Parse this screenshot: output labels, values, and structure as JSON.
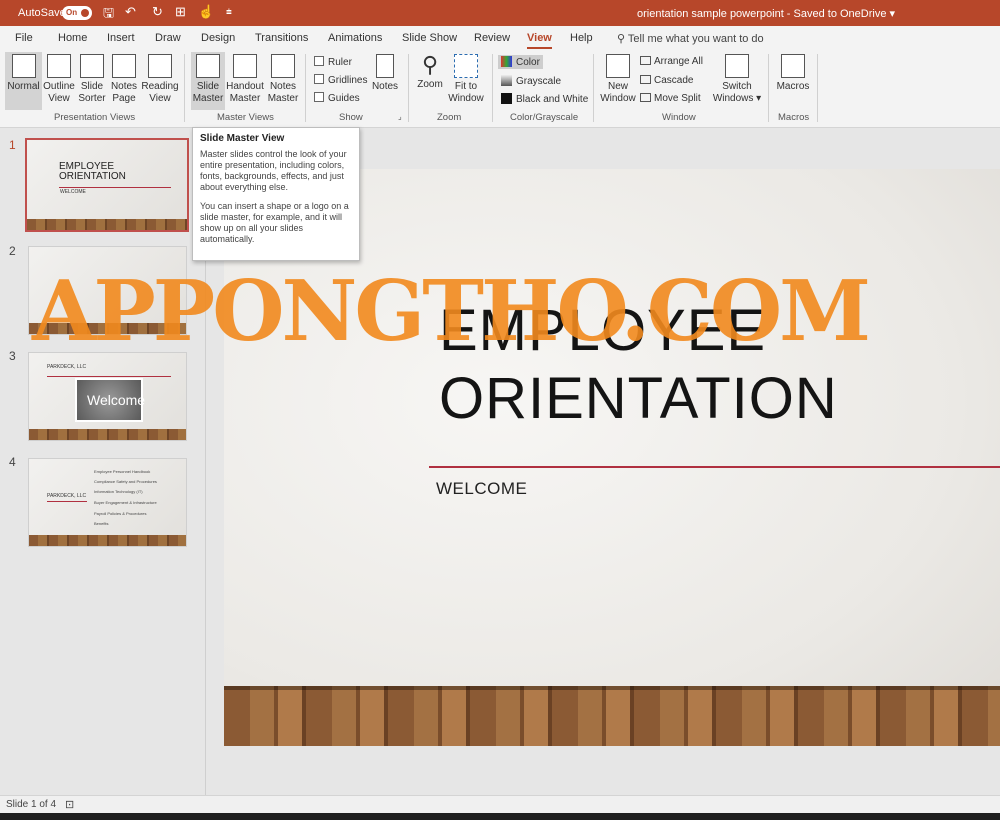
{
  "titlebar": {
    "autosave_label": "AutoSave",
    "autosave_state": "On",
    "document_title": "orientation sample powerpoint  -  Saved to OneDrive ▾"
  },
  "tabs": [
    "File",
    "Home",
    "Insert",
    "Draw",
    "Design",
    "Transitions",
    "Animations",
    "Slide Show",
    "Review",
    "View",
    "Help"
  ],
  "active_tab": "View",
  "tell_me": "Tell me what you want to do",
  "ribbon": {
    "presentation_views": {
      "label": "Presentation Views",
      "normal": "Normal",
      "outline_1": "Outline",
      "outline_2": "View",
      "sorter_1": "Slide",
      "sorter_2": "Sorter",
      "notes_1": "Notes",
      "notes_2": "Page",
      "reading_1": "Reading",
      "reading_2": "View"
    },
    "master_views": {
      "label": "Master Views",
      "slide_1": "Slide",
      "slide_2": "Master",
      "handout_1": "Handout",
      "handout_2": "Master",
      "notes_1": "Notes",
      "notes_2": "Master"
    },
    "show": {
      "label": "Show",
      "ruler": "Ruler",
      "gridlines": "Gridlines",
      "guides": "Guides",
      "notes": "Notes"
    },
    "zoom": {
      "label": "Zoom",
      "zoom": "Zoom",
      "fit_1": "Fit to",
      "fit_2": "Window"
    },
    "color": {
      "label": "Color/Grayscale",
      "color": "Color",
      "grayscale": "Grayscale",
      "bw": "Black and White"
    },
    "window": {
      "label": "Window",
      "new_1": "New",
      "new_2": "Window",
      "arrange_all": "Arrange All",
      "cascade": "Cascade",
      "move_split": "Move Split",
      "switch_1": "Switch",
      "switch_2": "Windows ▾"
    },
    "macros": {
      "label": "Macros",
      "macros": "Macros"
    }
  },
  "tooltip": {
    "title": "Slide Master View",
    "para1": "Master slides control the look of your entire presentation, including colors, fonts, backgrounds, effects, and just about everything else.",
    "para2": "You can insert a shape or a logo on a slide master, for example, and it will show up on all your slides automatically."
  },
  "slides": {
    "numbers": [
      "1",
      "2",
      "3",
      "4"
    ],
    "thumb1": {
      "title_1": "EMPLOYEE",
      "title_2": "ORIENTATION",
      "sub": "WELCOME"
    },
    "thumb3": {
      "heading": "PARKDECK, LLC",
      "image_text": "Welcome"
    },
    "thumb4": {
      "heading": "PARKDECK, LLC",
      "bullets": [
        "Employee Personnel Handbook",
        "Compliance Safety and Procedures",
        "Information Technology (IT)",
        "Buyer Engagement & Infrastructure",
        "Payroll Policies & Procedures",
        "Benefits"
      ]
    }
  },
  "current_slide": {
    "title_line1": "EMPLOYEE",
    "title_line2": "ORIENTATION",
    "subtitle": "WELCOME"
  },
  "watermark": "APPONGTHO.COM",
  "status": {
    "slide_of": "Slide 1 of 4"
  },
  "colors": {
    "accent": "#b7472a",
    "title_rule": "#b03040",
    "watermark": "#f28a1e"
  }
}
